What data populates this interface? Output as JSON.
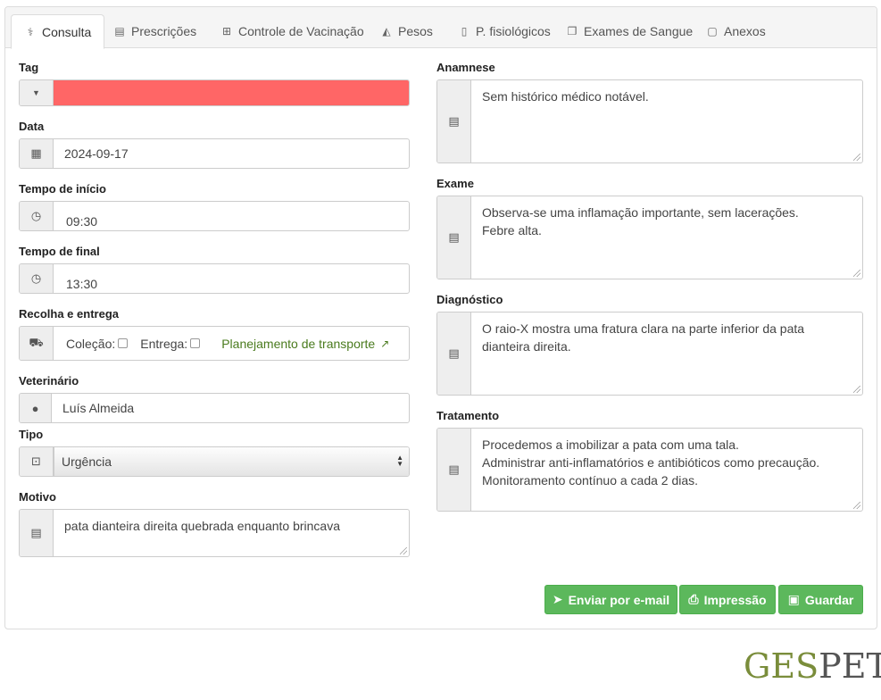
{
  "tabs": [
    {
      "label": "Consulta",
      "icon": "stethoscope-icon",
      "active": true
    },
    {
      "label": "Prescrições",
      "icon": "keyboard-icon"
    },
    {
      "label": "Controle de Vacinação",
      "icon": "medkit-icon"
    },
    {
      "label": "Pesos",
      "icon": "area-chart-icon"
    },
    {
      "label": "P. fisiológicos",
      "icon": "thermometer-icon"
    },
    {
      "label": "Exames de Sangue",
      "icon": "copy-icon"
    },
    {
      "label": "Anexos",
      "icon": "file-icon"
    }
  ],
  "form": {
    "tag": {
      "label": "Tag",
      "color": "#ff6666"
    },
    "date": {
      "label": "Data",
      "value": "2024-09-17"
    },
    "start_time": {
      "label": "Tempo de início",
      "value": "09:30"
    },
    "end_time": {
      "label": "Tempo de final",
      "value": "13:30"
    },
    "pickup": {
      "label": "Recolha e entrega",
      "collection_label": "Coleção:",
      "delivery_label": "Entrega:",
      "transport_link": "Planejamento de transporte"
    },
    "vet": {
      "label": "Veterinário",
      "value": "Luís Almeida"
    },
    "type": {
      "label": "Tipo",
      "value": "Urgência"
    },
    "reason": {
      "label": "Motivo",
      "value": "pata dianteira direita quebrada enquanto brincava"
    },
    "anamnesis": {
      "label": "Anamnese",
      "value": "Sem histórico médico notável."
    },
    "exam": {
      "label": "Exame",
      "value": "Observa-se uma inflamação importante, sem lacerações.\nFebre alta."
    },
    "diagnosis": {
      "label": "Diagnóstico",
      "value": "O raio-X mostra uma fratura clara na parte inferior da pata dianteira direita."
    },
    "treatment": {
      "label": "Tratamento",
      "value": "Procedemos a imobilizar a pata com uma tala.\nAdministrar anti-inflamatórios e antibióticos como precaução.\nMonitoramento contínuo a cada 2 dias."
    }
  },
  "actions": {
    "email": "Enviar por e-mail",
    "print": "Impressão",
    "save": "Guardar"
  },
  "logo": {
    "part1": "GES",
    "part2": "PET"
  },
  "colors": {
    "accent_green": "#5cb85c",
    "tag_red": "#ff6666",
    "link_green": "#4a7b1e"
  }
}
